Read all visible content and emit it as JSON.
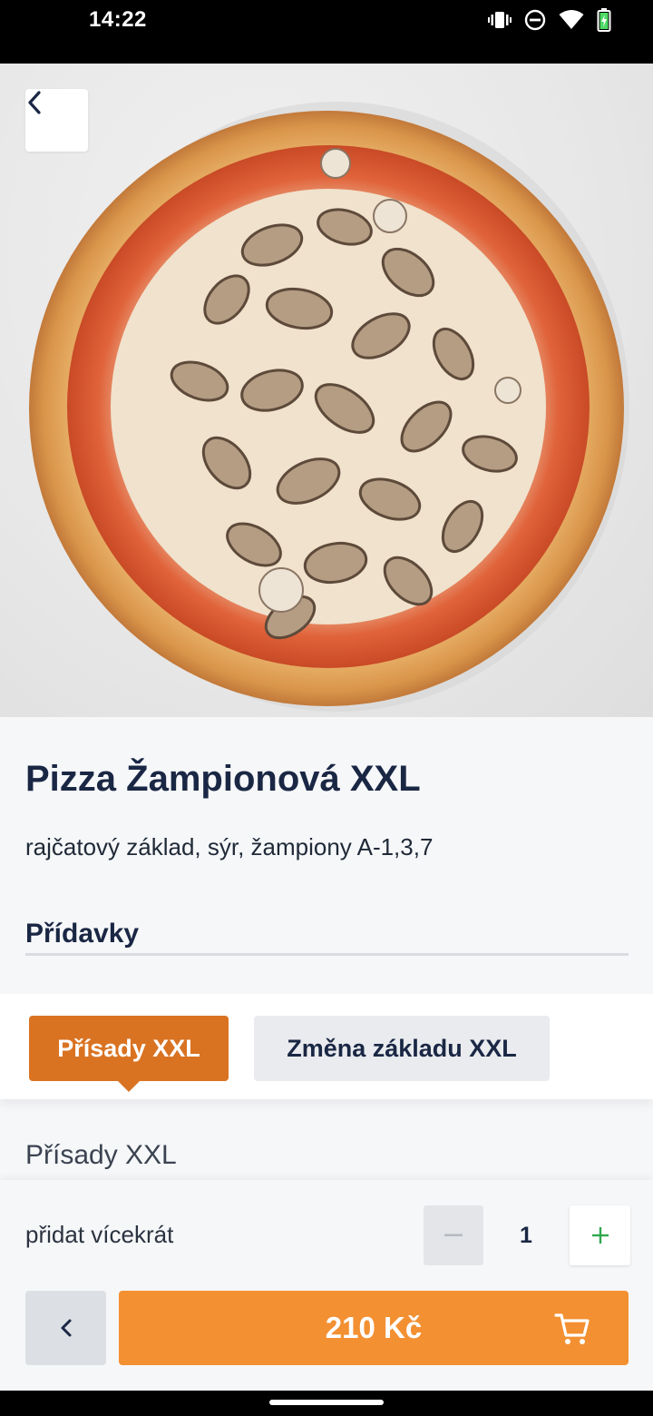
{
  "status_bar": {
    "time": "14:22"
  },
  "product": {
    "title": "Pizza Žampionová XXL",
    "description": "rajčatový základ, sýr, žampiony A-1,3,7"
  },
  "extras": {
    "heading": "Přídavky"
  },
  "tabs": [
    {
      "label": "Přísady XXL",
      "active": true
    },
    {
      "label": "Změna základu XXL",
      "active": false
    }
  ],
  "section": {
    "label": "Přísady XXL"
  },
  "quantity": {
    "label": "přidat vícekrát",
    "value": "1"
  },
  "cart": {
    "price": "210 Kč"
  },
  "colors": {
    "accent": "#f39032",
    "tab_active": "#d97322",
    "title": "#1a2744",
    "plus": "#2fa84f"
  }
}
